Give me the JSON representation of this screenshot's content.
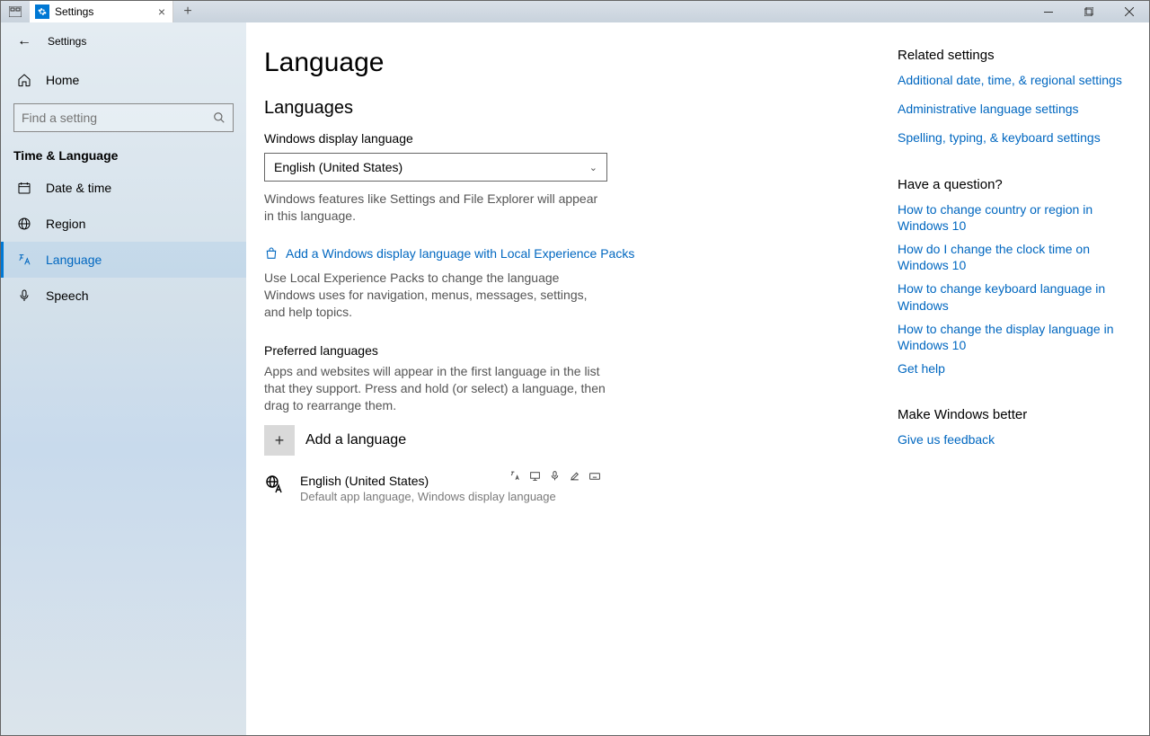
{
  "window": {
    "tab_title": "Settings",
    "header_label": "Settings"
  },
  "sidebar": {
    "home": "Home",
    "search_placeholder": "Find a setting",
    "category": "Time & Language",
    "items": [
      {
        "label": "Date & time"
      },
      {
        "label": "Region"
      },
      {
        "label": "Language"
      },
      {
        "label": "Speech"
      }
    ]
  },
  "page": {
    "title": "Language",
    "section1": "Languages",
    "display_lang_label": "Windows display language",
    "display_lang_value": "English (United States)",
    "display_lang_desc": "Windows features like Settings and File Explorer will appear in this language.",
    "add_display_lang": "Add a Windows display language with Local Experience Packs",
    "lep_desc": "Use Local Experience Packs to change the language Windows uses for navigation, menus, messages, settings, and help topics.",
    "preferred_label": "Preferred languages",
    "preferred_desc": "Apps and websites will appear in the first language in the list that they support. Press and hold (or select) a language, then drag to rearrange them.",
    "add_language": "Add a language",
    "lang_entry_name": "English (United States)",
    "lang_entry_sub": "Default app language, Windows display language"
  },
  "right": {
    "related_title": "Related settings",
    "related_links": [
      "Additional date, time, & regional settings",
      "Administrative language settings",
      "Spelling, typing, & keyboard settings"
    ],
    "question_title": "Have a question?",
    "question_links": [
      "How to change country or region in Windows 10",
      "How do I change the clock time on Windows 10",
      "How to change keyboard language in Windows",
      "How to change the display language in Windows 10",
      "Get help"
    ],
    "better_title": "Make Windows better",
    "feedback": "Give us feedback"
  }
}
